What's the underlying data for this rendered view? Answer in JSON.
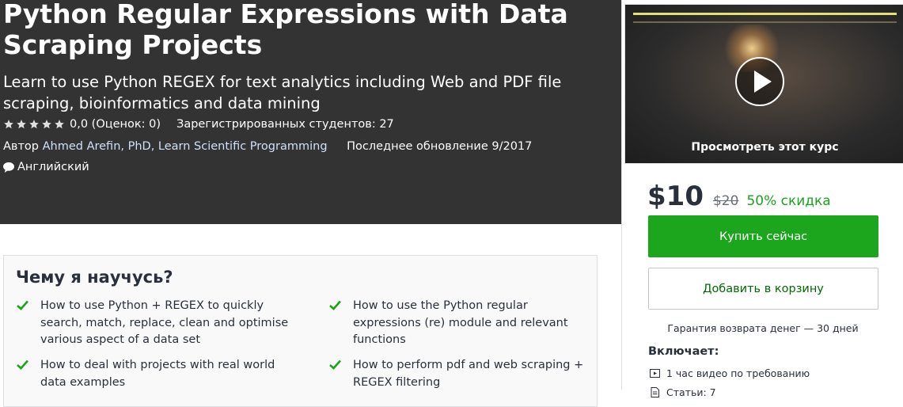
{
  "course": {
    "title": "Python Regular Expressions with Data Scraping Projects",
    "subtitle": "Learn to use Python REGEX for text analytics including Web and PDF file scraping, bioinformatics and data mining",
    "rating_text": "0,0 (Оценок: 0)",
    "stars_filled": 0,
    "stars_total": 5,
    "students_text": "Зарегистрированных студентов: 27",
    "author_prefix": "Автор",
    "author_names": "Ahmed Arefin, PhD, Learn Scientific Programming",
    "updated_text": "Последнее обновление 9/2017",
    "language": "Английский"
  },
  "sidebar": {
    "preview_caption": "Просмотреть этот курс",
    "price_current": "$10",
    "price_old": "$20",
    "discount": "50% скидка",
    "buy_label": "Купить сейчас",
    "cart_label": "Добавить в корзину",
    "guarantee": "Гарантия возврата денег — 30 дней",
    "includes_title": "Включает:",
    "includes": [
      {
        "icon": "video-icon",
        "text": "1 час видео по требованию"
      },
      {
        "icon": "article-icon",
        "text": "Статьи: 7"
      }
    ]
  },
  "learn": {
    "title": "Чему я научусь?",
    "items": [
      "How to use Python + REGEX to quickly search, match, replace, clean and optimise various aspect of a data set",
      "How to use the Python regular expressions (re) module and relevant functions",
      "How to deal with projects with real world data examples",
      "How to perform pdf and web scraping + REGEX filtering"
    ]
  },
  "colors": {
    "hero_bg": "#333333",
    "buy_green": "#1ca61e",
    "discount_green": "#1aa41c",
    "check_green": "#1aa41c"
  }
}
